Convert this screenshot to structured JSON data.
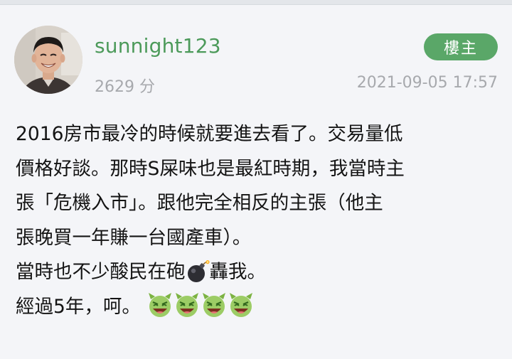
{
  "post": {
    "author": {
      "username": "sunnight123",
      "score_text": "2629 分",
      "avatar_icon": "user-avatar-photo"
    },
    "op_badge_label": "樓主",
    "timestamp": "2021-09-05 17:57",
    "body_lines": [
      "2016房市最冷的時候就要進去看了。交易量低",
      "價格好談。那時S屎味也是最紅時期，我當時主",
      "張「危機入市」。跟他完全相反的主張（他主",
      "張晚買一年賺一台國產車）。",
      {
        "before": "當時也不少酸民在砲",
        "emoji": "bomb-emoji-icon",
        "after": "轟我。"
      },
      {
        "text": "經過5年，呵。",
        "emojis": [
          "green-devil-laugh-emoji-icon",
          "green-devil-laugh-emoji-icon",
          "green-devil-laugh-emoji-icon",
          "green-devil-laugh-emoji-icon"
        ]
      }
    ]
  },
  "colors": {
    "background": "#f4f5f8",
    "username": "#4c9a5a",
    "badge_bg": "#5aa768",
    "badge_text": "#ffffff",
    "meta_text": "#a7a9ad",
    "body_text": "#141414"
  }
}
